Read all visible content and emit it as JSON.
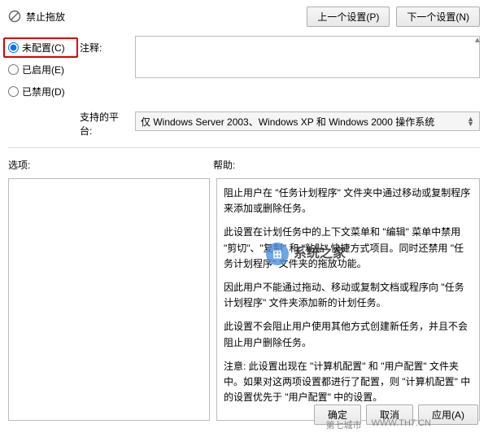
{
  "title": "禁止拖放",
  "nav": {
    "prev": "上一个设置(P)",
    "next": "下一个设置(N)"
  },
  "radios": {
    "not_configured": "未配置(C)",
    "enabled": "已启用(E)",
    "disabled": "已禁用(D)",
    "selected": "not_configured"
  },
  "labels": {
    "comments": "注释:",
    "platform": "支持的平台:",
    "options": "选项:",
    "help": "帮助:"
  },
  "platform_text": "仅 Windows Server 2003、Windows XP 和 Windows 2000 操作系统",
  "help_paragraphs": [
    "阻止用户在 \"任务计划程序\" 文件夹中通过移动或复制程序来添加或删除任务。",
    "此设置在计划任务中的上下文菜单和 \"编辑\" 菜单中禁用 \"剪切\"、\"复制\" 和 \"粘贴\" 快捷方式项目。同时还禁用 \"任务计划程序\" 文件夹的拖放功能。",
    "因此用户不能通过拖动、移动或复制文档或程序向 \"任务计划程序\" 文件夹添加新的计划任务。",
    "此设置不会阻止用户使用其他方式创建新任务，并且不会阻止用户删除任务。",
    "注意: 此设置出现在 \"计算机配置\" 和 \"用户配置\" 文件夹中。如果对这两项设置都进行了配置，则 \"计算机配置\" 中的设置优先于 \"用户配置\" 中的设置。"
  ],
  "watermark": {
    "brand": "系统之家"
  },
  "buttons": {
    "ok": "确定",
    "cancel": "取消",
    "apply": "应用(A)"
  },
  "footer_wm": {
    "site1": "第七城市",
    "site2": "WWW.TH7.CN"
  }
}
